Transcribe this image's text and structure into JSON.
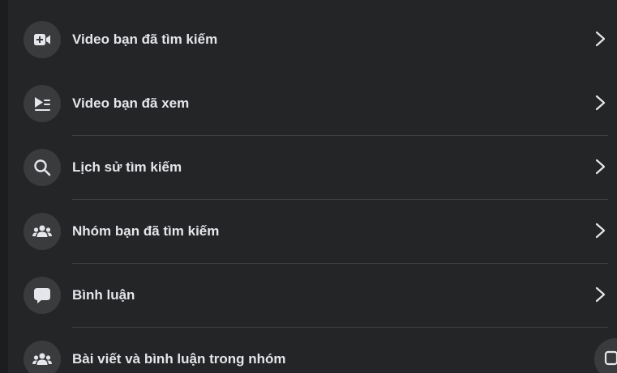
{
  "menu": {
    "items": [
      {
        "label": "Video bạn đã tìm kiếm",
        "icon": "video-add-icon"
      },
      {
        "label": "Video bạn đã xem",
        "icon": "video-playlist-icon"
      },
      {
        "label": "Lịch sử tìm kiếm",
        "icon": "search-icon"
      },
      {
        "label": "Nhóm bạn đã tìm kiếm",
        "icon": "group-icon"
      },
      {
        "label": "Bình luận",
        "icon": "comment-icon"
      },
      {
        "label": "Bài viết và bình luận trong nhóm",
        "icon": "group-icon"
      }
    ]
  },
  "colors": {
    "background": "#242526",
    "icon_circle": "#3a3b3c",
    "text": "#e4e6eb",
    "divider": "#3e4042"
  }
}
